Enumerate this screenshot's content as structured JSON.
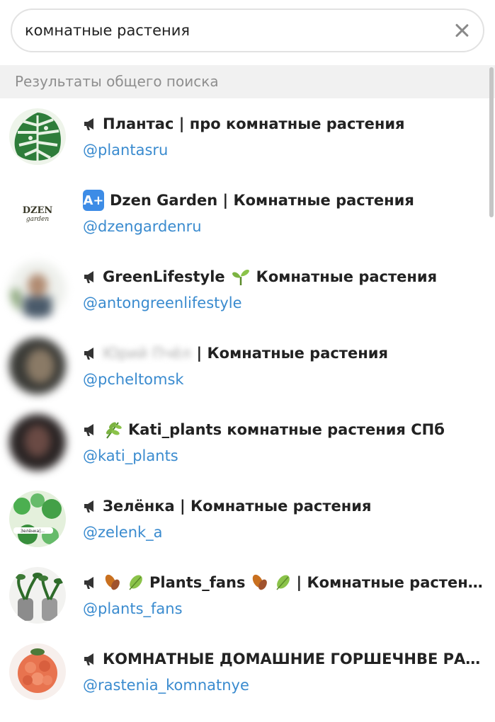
{
  "search": {
    "value": "комнатные растения"
  },
  "section_header": "Результаты общего поиска",
  "results": [
    {
      "name": "Плантас | про комнатные растения",
      "handle": "@plantasru",
      "icon": "megaphone-icon"
    },
    {
      "name": "Dzen Garden | Комнатные растения",
      "handle": "@dzengardenru",
      "icon": "a-plus-badge-icon",
      "avatar_text_1": "DZEN",
      "avatar_text_2": "garden"
    },
    {
      "name_a": "GreenLifestyle",
      "name_b": "Комнатные растения",
      "handle": "@antongreenlifestyle",
      "icon": "megaphone-icon",
      "emoji": "seedling-icon"
    },
    {
      "name_hidden": "Юрий Пчёл",
      "name": "| Комнатные растения",
      "handle": "@pcheltomsk",
      "icon": "megaphone-icon"
    },
    {
      "name": "Kati_plants комнатные растения СПб",
      "handle": "@kati_plants",
      "icon": "megaphone-icon",
      "emoji": "herb-icon"
    },
    {
      "name": "Зелёнка | Комнатные растения",
      "handle": "@zelenk_a",
      "icon": "megaphone-icon",
      "avatar_text": "Зелёнка|..."
    },
    {
      "name_a": "Plants_fans",
      "name_b": "| Комнатные растения",
      "handle": "@plants_fans",
      "icon": "megaphone-icon"
    },
    {
      "name": "КОМНАТНЫЕ ДОМАШНИЕ ГОРШЕЧНВЕ РАСТЕНИЯ",
      "handle": "@rastenia_komnatnye",
      "icon": "megaphone-icon"
    }
  ],
  "colors": {
    "link": "#3a8bcf",
    "header_bg": "#f1f1f1",
    "badge": "#3d8ce6"
  }
}
